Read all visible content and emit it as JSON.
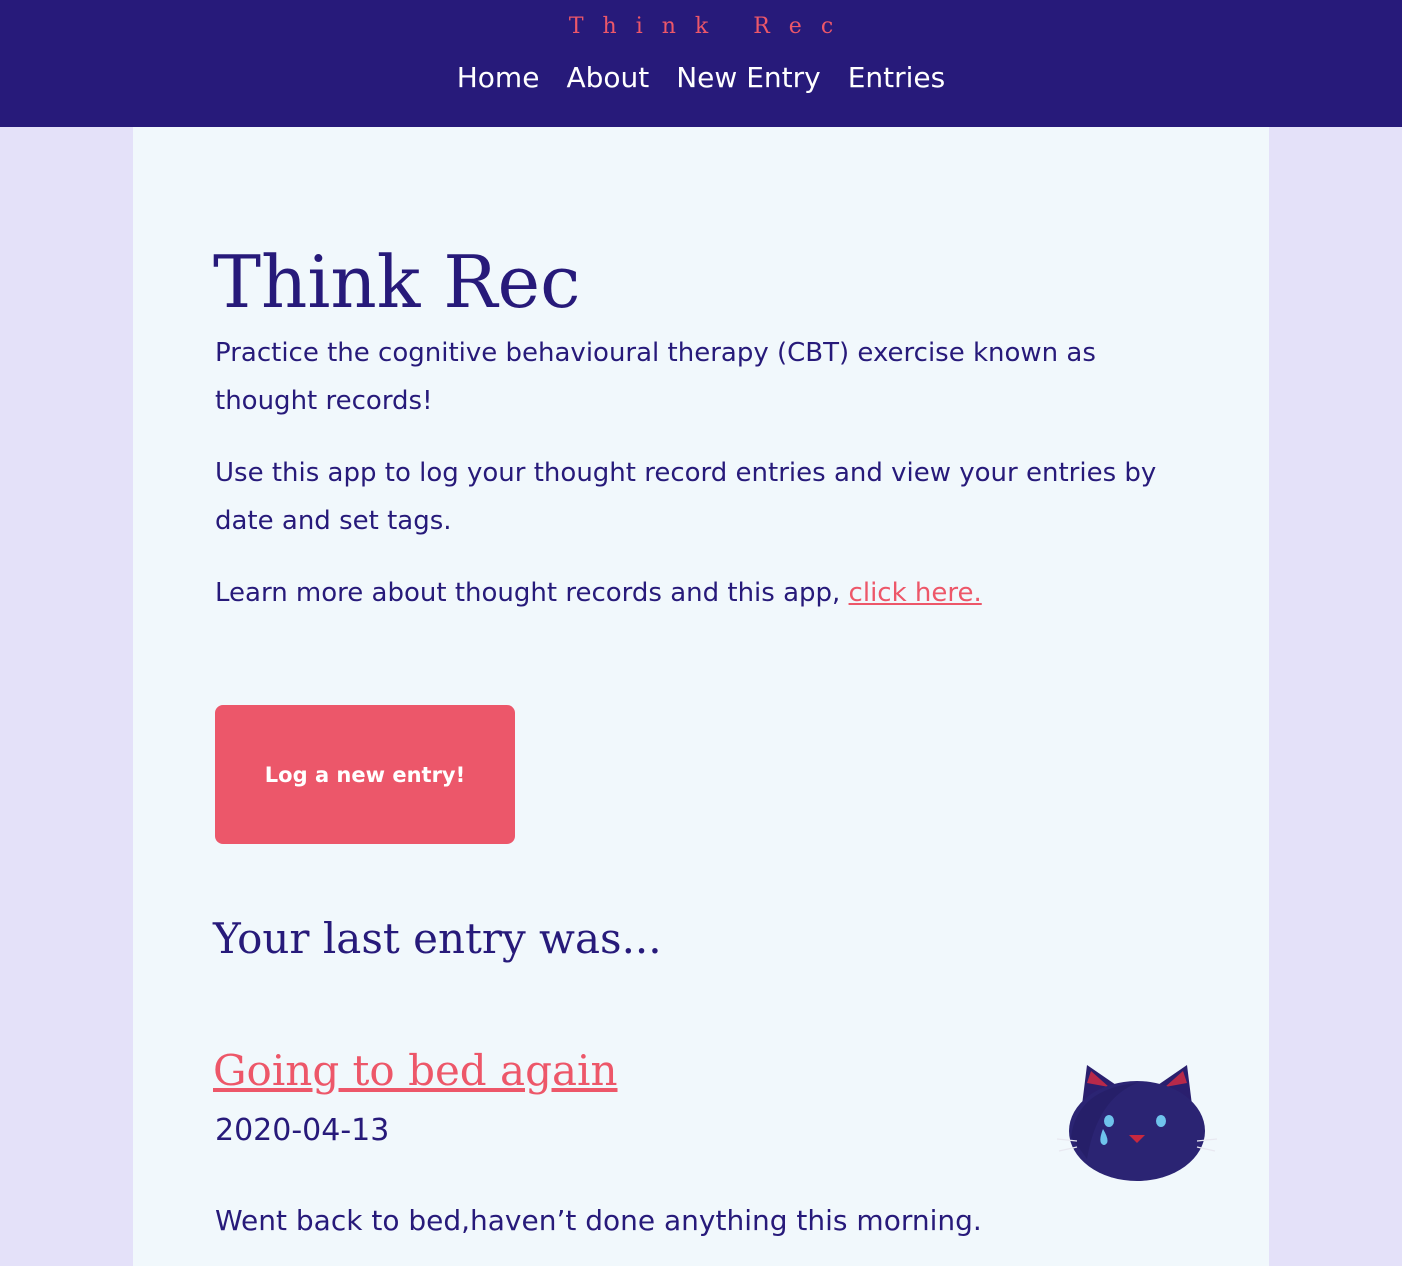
{
  "header": {
    "brand": "Think Rec",
    "nav": [
      {
        "label": "Home"
      },
      {
        "label": "About"
      },
      {
        "label": "New Entry"
      },
      {
        "label": "Entries"
      }
    ]
  },
  "main": {
    "title": "Think Rec",
    "intro": "Practice the cognitive behavioural therapy (CBT) exercise known as thought records!",
    "usage": "Use this app to log your thought record entries and view your entries by date and set tags.",
    "learn_more": "Learn more about thought records and this app, ",
    "learn_more_link": "click here.",
    "cta_label": "Log a new entry!",
    "last_entry_heading": "Your last entry was..."
  },
  "last_entry": {
    "title": "Going to bed again",
    "date": "2020-04-13",
    "text": "Went back to bed,haven’t done anything this morning.",
    "mood_icon": "sad-cat-icon"
  },
  "colors": {
    "header_bg": "#271a7a",
    "page_bg": "#e4e1f9",
    "content_bg": "#f1f8fc",
    "accent": "#ed5769",
    "text": "#271a7a"
  }
}
